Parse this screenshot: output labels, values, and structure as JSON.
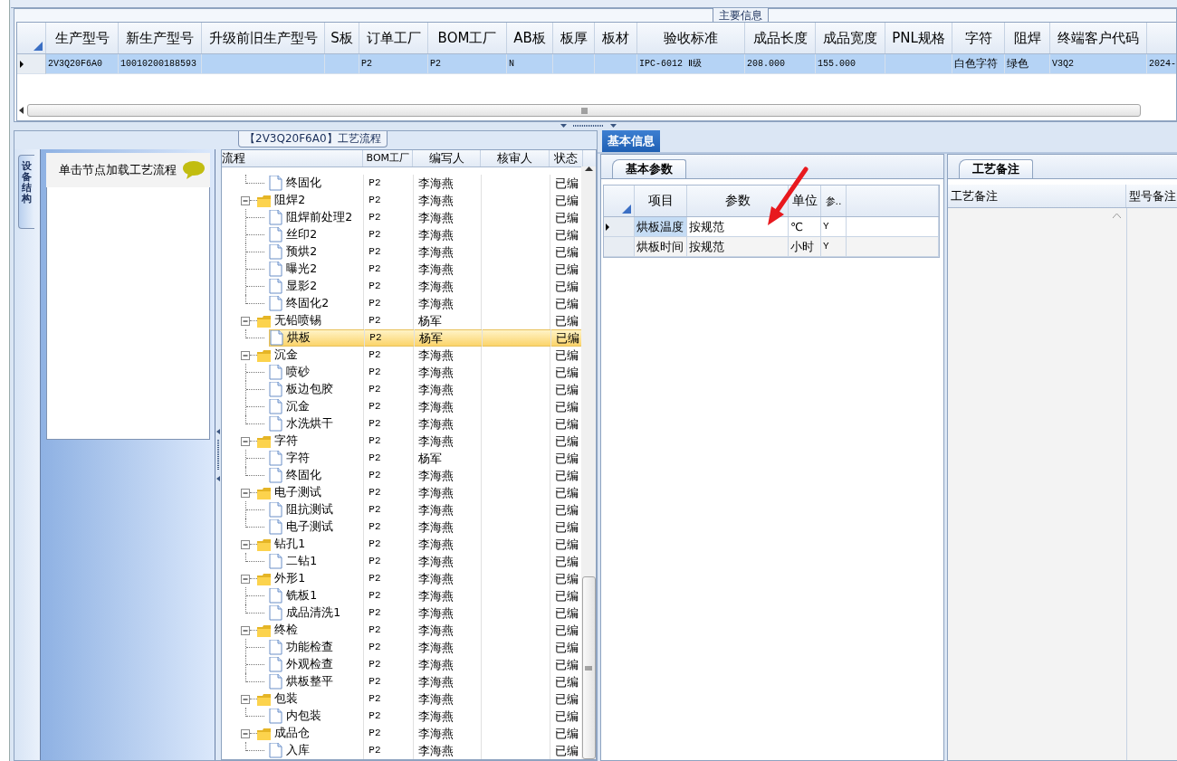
{
  "main_info": {
    "title": "主要信息",
    "columns": [
      "生产型号",
      "新生产型号",
      "升级前旧生产型号",
      "S板",
      "订单工厂",
      "BOM工厂",
      "AB板",
      "板厚",
      "板材",
      "验收标准",
      "成品长度",
      "成品宽度",
      "PNL规格",
      "字符",
      "阻焊",
      "终端客户代码"
    ],
    "rows": [
      {
        "selected": true,
        "cells": [
          "2V3Q20F6A0",
          "10010200188593",
          null,
          null,
          "P2",
          "P2",
          "N",
          null,
          null,
          "IPC-6012 Ⅱ级",
          "208.000",
          "155.000",
          null,
          "白色字符",
          "绿色",
          "V3Q2",
          "2024-"
        ]
      }
    ]
  },
  "process": {
    "title": "【2V3Q20F6A0】工艺流程",
    "side_tab": {
      "label": "设备结构",
      "selected": true
    },
    "hint": "单击节点加载工艺流程",
    "columns": [
      "流程",
      "BOM工厂",
      "编写人",
      "核审人",
      "状态"
    ],
    "tree": [
      {
        "kind": "hidden",
        "children": [
          {
            "kind": "file",
            "label": "终固化",
            "bom_factory": "P2",
            "author": "李海燕",
            "status": "已编",
            "selected": false
          }
        ]
      },
      {
        "kind": "folder",
        "label": "阻焊2",
        "bom_factory": "P2",
        "author": "李海燕",
        "status": "已编",
        "selected": false,
        "expanded": true,
        "children": [
          {
            "kind": "file",
            "label": "阻焊前处理2",
            "bom_factory": "P2",
            "author": "李海燕",
            "status": "已编",
            "selected": false
          },
          {
            "kind": "file",
            "label": "丝印2",
            "bom_factory": "P2",
            "author": "李海燕",
            "status": "已编",
            "selected": false
          },
          {
            "kind": "file",
            "label": "预烘2",
            "bom_factory": "P2",
            "author": "李海燕",
            "status": "已编",
            "selected": false
          },
          {
            "kind": "file",
            "label": "曝光2",
            "bom_factory": "P2",
            "author": "李海燕",
            "status": "已编",
            "selected": false
          },
          {
            "kind": "file",
            "label": "显影2",
            "bom_factory": "P2",
            "author": "李海燕",
            "status": "已编",
            "selected": false
          },
          {
            "kind": "file",
            "label": "终固化2",
            "bom_factory": "P2",
            "author": "李海燕",
            "status": "已编",
            "selected": false
          }
        ]
      },
      {
        "kind": "folder",
        "label": "无铅喷锡",
        "bom_factory": "P2",
        "author": "杨军",
        "status": "已编",
        "selected": false,
        "expanded": true,
        "children": [
          {
            "kind": "file",
            "label": "烘板",
            "bom_factory": "P2",
            "author": "杨军",
            "status": "已编",
            "selected": true
          }
        ]
      },
      {
        "kind": "folder",
        "label": "沉金",
        "bom_factory": "P2",
        "author": "李海燕",
        "status": "已编",
        "selected": false,
        "expanded": true,
        "children": [
          {
            "kind": "file",
            "label": "喷砂",
            "bom_factory": "P2",
            "author": "李海燕",
            "status": "已编",
            "selected": false
          },
          {
            "kind": "file",
            "label": "板边包胶",
            "bom_factory": "P2",
            "author": "李海燕",
            "status": "已编",
            "selected": false
          },
          {
            "kind": "file",
            "label": "沉金",
            "bom_factory": "P2",
            "author": "李海燕",
            "status": "已编",
            "selected": false
          },
          {
            "kind": "file",
            "label": "水洗烘干",
            "bom_factory": "P2",
            "author": "李海燕",
            "status": "已编",
            "selected": false
          }
        ]
      },
      {
        "kind": "folder",
        "label": "字符",
        "bom_factory": "P2",
        "author": "李海燕",
        "status": "已编",
        "selected": false,
        "expanded": true,
        "children": [
          {
            "kind": "file",
            "label": "字符",
            "bom_factory": "P2",
            "author": "杨军",
            "status": "已编",
            "selected": false
          },
          {
            "kind": "file",
            "label": "终固化",
            "bom_factory": "P2",
            "author": "李海燕",
            "status": "已编",
            "selected": false
          }
        ]
      },
      {
        "kind": "folder",
        "label": "电子测试",
        "bom_factory": "P2",
        "author": "李海燕",
        "status": "已编",
        "selected": false,
        "expanded": true,
        "children": [
          {
            "kind": "file",
            "label": "阻抗测试",
            "bom_factory": "P2",
            "author": "李海燕",
            "status": "已编",
            "selected": false
          },
          {
            "kind": "file",
            "label": "电子测试",
            "bom_factory": "P2",
            "author": "李海燕",
            "status": "已编",
            "selected": false
          }
        ]
      },
      {
        "kind": "folder",
        "label": "钻孔1",
        "bom_factory": "P2",
        "author": "李海燕",
        "status": "已编",
        "selected": false,
        "expanded": true,
        "children": [
          {
            "kind": "file",
            "label": "二钻1",
            "bom_factory": "P2",
            "author": "李海燕",
            "status": "已编",
            "selected": false
          }
        ]
      },
      {
        "kind": "folder",
        "label": "外形1",
        "bom_factory": "P2",
        "author": "李海燕",
        "status": "已编",
        "selected": false,
        "expanded": true,
        "children": [
          {
            "kind": "file",
            "label": "铣板1",
            "bom_factory": "P2",
            "author": "李海燕",
            "status": "已编",
            "selected": false
          },
          {
            "kind": "file",
            "label": "成品清洗1",
            "bom_factory": "P2",
            "author": "李海燕",
            "status": "已编",
            "selected": false
          }
        ]
      },
      {
        "kind": "folder",
        "label": "终检",
        "bom_factory": "P2",
        "author": "李海燕",
        "status": "已编",
        "selected": false,
        "expanded": true,
        "children": [
          {
            "kind": "file",
            "label": "功能检查",
            "bom_factory": "P2",
            "author": "李海燕",
            "status": "已编",
            "selected": false
          },
          {
            "kind": "file",
            "label": "外观检查",
            "bom_factory": "P2",
            "author": "李海燕",
            "status": "已编",
            "selected": false
          },
          {
            "kind": "file",
            "label": "烘板整平",
            "bom_factory": "P2",
            "author": "李海燕",
            "status": "已编",
            "selected": false
          }
        ]
      },
      {
        "kind": "folder",
        "label": "包装",
        "bom_factory": "P2",
        "author": "李海燕",
        "status": "已编",
        "selected": false,
        "expanded": true,
        "children": [
          {
            "kind": "file",
            "label": "内包装",
            "bom_factory": "P2",
            "author": "李海燕",
            "status": "已编",
            "selected": false
          }
        ]
      },
      {
        "kind": "folder",
        "label": "成品仓",
        "bom_factory": "P2",
        "author": "李海燕",
        "status": "已编",
        "selected": false,
        "expanded": true,
        "children": [
          {
            "kind": "file",
            "label": "入库",
            "bom_factory": "P2",
            "author": "李海燕",
            "status": "已编",
            "selected": false
          }
        ]
      }
    ]
  },
  "detail_tabs": [
    {
      "label": "基本信息",
      "selected": true
    }
  ],
  "basic_params": {
    "tab": {
      "label": "基本参数",
      "selected": true
    },
    "columns": [
      "项目",
      "参数",
      "单位",
      "参.."
    ],
    "rows": [
      {
        "selected": true,
        "cells": [
          "烘板温度",
          "按规范",
          "℃",
          "Y"
        ]
      },
      {
        "selected": false,
        "cells": [
          "烘板时间",
          "按规范",
          "小时",
          "Y"
        ]
      }
    ]
  },
  "notes": {
    "tab": {
      "label": "工艺备注",
      "selected": true
    },
    "columns": [
      "工艺备注",
      "型号备注"
    ]
  }
}
